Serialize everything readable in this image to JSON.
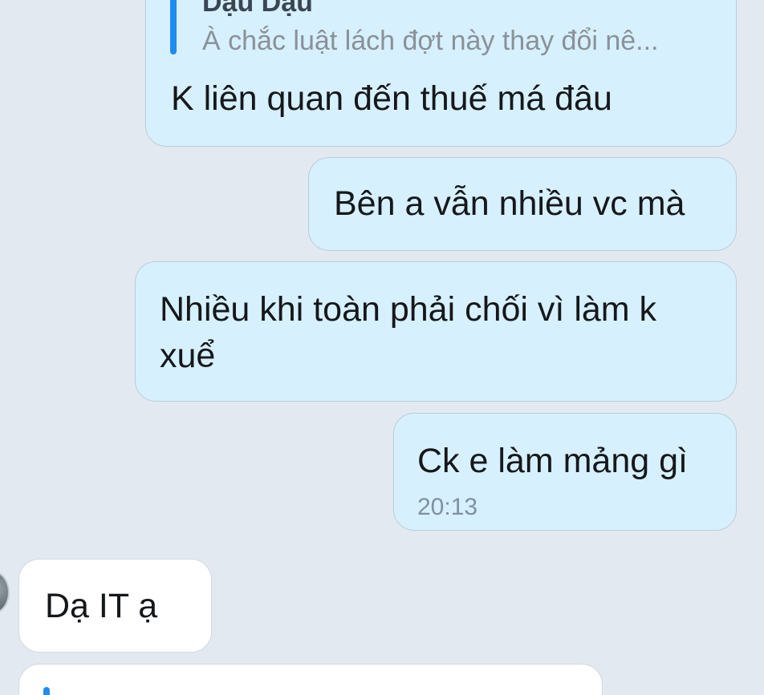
{
  "messages": [
    {
      "direction": "outgoing",
      "reply": {
        "sender": "Dậu Dậu",
        "snippet": "À chắc luật lách đợt này thay đổi nê..."
      },
      "text": "K liên quan đến thuế má đâu"
    },
    {
      "direction": "outgoing",
      "text": "Bên a vẫn nhiều vc mà"
    },
    {
      "direction": "outgoing",
      "text": "Nhiều khi toàn phải chối vì làm k xuể"
    },
    {
      "direction": "outgoing",
      "text": "Ck e làm mảng gì",
      "time": "20:13"
    },
    {
      "direction": "incoming",
      "text": "Dạ IT ạ"
    }
  ],
  "colors": {
    "background": "#e3e9f1",
    "outgoing_bubble": "#d7f0fe",
    "incoming_bubble": "#ffffff",
    "reply_accent": "#1f8cf0"
  }
}
